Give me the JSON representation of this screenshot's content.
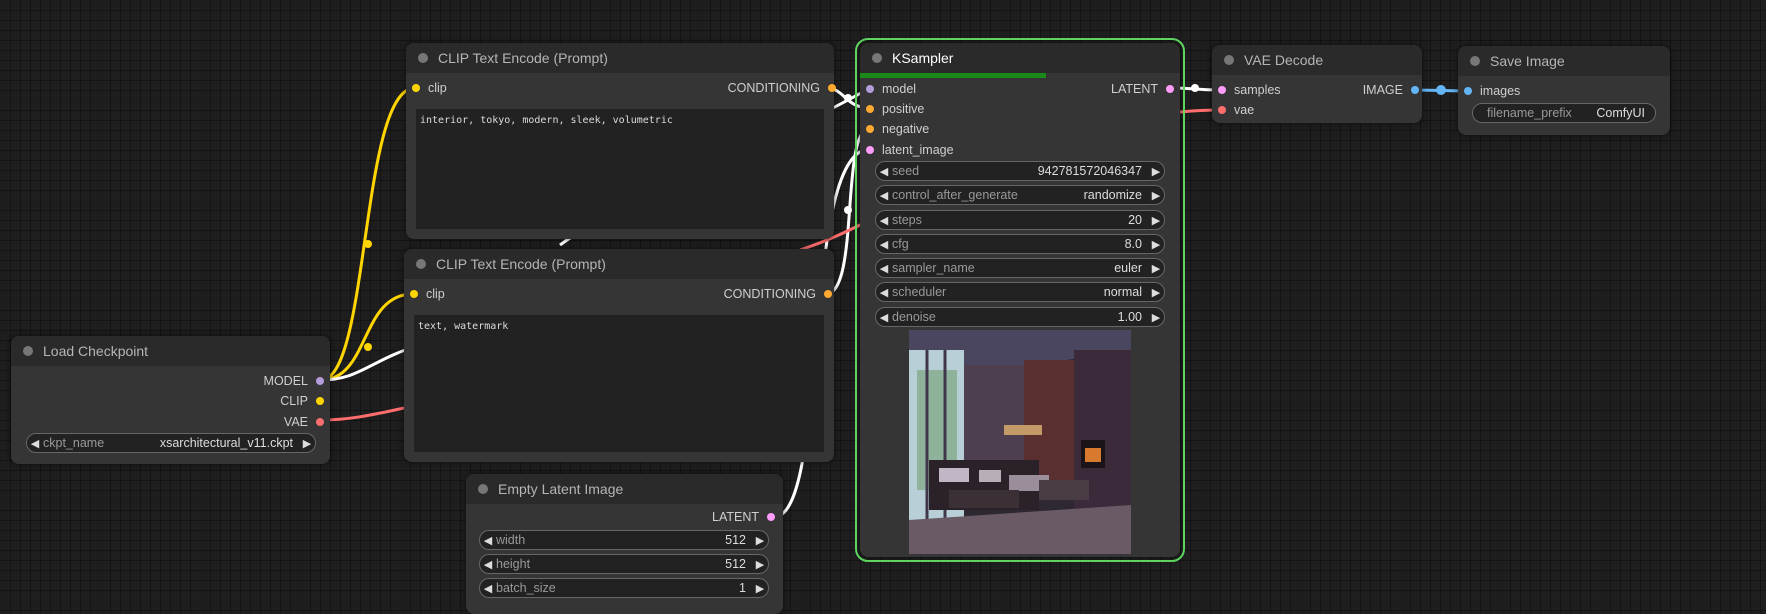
{
  "colors": {
    "model": "#b39ddb",
    "clip": "#ffd500",
    "vae": "#ff6e6e",
    "conditioning": "#ffa931",
    "latent": "#ff9cf9",
    "image": "#64b5f6",
    "selected": "#5fd35f",
    "progress": "#1b8a1b"
  },
  "clip_pos": {
    "title": "CLIP Text Encode (Prompt)",
    "input_label": "clip",
    "output_label": "CONDITIONING",
    "text": "interior, tokyo, modern, sleek, volumetric"
  },
  "clip_neg": {
    "title": "CLIP Text Encode (Prompt)",
    "input_label": "clip",
    "output_label": "CONDITIONING",
    "text": "text, watermark"
  },
  "load_checkpoint": {
    "title": "Load Checkpoint",
    "outputs": [
      "MODEL",
      "CLIP",
      "VAE"
    ],
    "widget_label": "ckpt_name",
    "widget_value": "xsarchitectural_v11.ckpt"
  },
  "empty_latent": {
    "title": "Empty Latent Image",
    "output_label": "LATENT",
    "widgets": [
      {
        "label": "width",
        "value": "512"
      },
      {
        "label": "height",
        "value": "512"
      },
      {
        "label": "batch_size",
        "value": "1"
      }
    ]
  },
  "ksampler": {
    "title": "KSampler",
    "progress": 0.6,
    "inputs": [
      "model",
      "positive",
      "negative",
      "latent_image"
    ],
    "output_label": "LATENT",
    "widgets": [
      {
        "label": "seed",
        "value": "942781572046347"
      },
      {
        "label": "control_after_generate",
        "value": "randomize"
      },
      {
        "label": "steps",
        "value": "20"
      },
      {
        "label": "cfg",
        "value": "8.0"
      },
      {
        "label": "sampler_name",
        "value": "euler"
      },
      {
        "label": "scheduler",
        "value": "normal"
      },
      {
        "label": "denoise",
        "value": "1.00"
      }
    ]
  },
  "vae_decode": {
    "title": "VAE Decode",
    "inputs": [
      "samples",
      "vae"
    ],
    "output_label": "IMAGE"
  },
  "save_image": {
    "title": "Save Image",
    "input_label": "images",
    "widget_label": "filename_prefix",
    "widget_value": "ComfyUI"
  },
  "icons": {
    "left": "◀",
    "right": "▶"
  }
}
